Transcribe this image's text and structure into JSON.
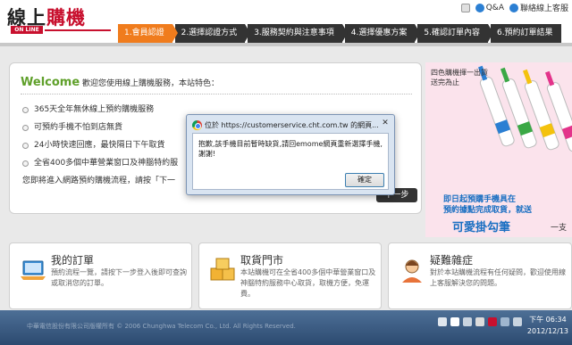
{
  "header": {
    "logo_main_left": "線上",
    "logo_main_right": "購機",
    "logo_sub": "ON LINE",
    "top_links": [
      {
        "label": "",
        "icon": "home-icon"
      },
      {
        "label": "Q&A",
        "icon": "qa-icon"
      },
      {
        "label": "聯絡線上客服",
        "icon": "customer-service-icon"
      }
    ],
    "steps": [
      {
        "label": "1.會員認證",
        "active": true
      },
      {
        "label": "2.選擇認證方式",
        "active": false
      },
      {
        "label": "3.服務契約與注意事項",
        "active": false
      },
      {
        "label": "4.選擇優惠方案",
        "active": false
      },
      {
        "label": "5.確認訂單內容",
        "active": false
      },
      {
        "label": "6.預約訂單結果",
        "active": false
      }
    ]
  },
  "welcome": {
    "title": "Welcome",
    "subtitle": "歡迎您使用線上購機服務，本站特色：",
    "features": [
      "365天全年無休線上預約購機服務",
      "可預約手機不怕到店無貨",
      "24小時快速回應，最快隔日下午取貨",
      "全省400多個中華營業窗口及神腦特約服"
    ],
    "invite": "您即將進入網路預約購機流程，請按「下一",
    "next_label": "下一步"
  },
  "ad": {
    "top_text": "四色購機揮一出貨\n送完為止",
    "promo_line1": "即日起預購手機具在",
    "promo_line2": "預約據點完成取貨，就送",
    "big_text": "可愛掛勾筆",
    "unit": "一支"
  },
  "cards": [
    {
      "title": "我的訂單",
      "desc": "預約流程一覽，請按下一步登入後即可查詢或取消您的訂單。",
      "icon": "laptop-icon"
    },
    {
      "title": "取貨門市",
      "desc": "本站購機可在全省400多個中華營業窗口及神腦特約服務中心取貨，取機方便，免運費。",
      "icon": "boxes-icon"
    },
    {
      "title": "疑難雜症",
      "desc": "對於本站購機流程有任何疑問，歡迎使用線上客服解決您的問題。",
      "icon": "support-agent-icon"
    }
  ],
  "taskbar": {
    "footer_text": "中華電信股份有限公司版權所有 © 2006 Chunghwa Telecom Co., Ltd. All Rights Reserved.",
    "time": "下午 06:34",
    "date": "2012/12/13"
  },
  "dialog": {
    "title": "位於 https://customerservice.cht.com.tw 的網頁...",
    "message": "抱歉,該手機目前暫時缺貨,請回emome網頁重新選擇手機,謝謝!",
    "ok_label": "確定",
    "close_label": "✕"
  }
}
